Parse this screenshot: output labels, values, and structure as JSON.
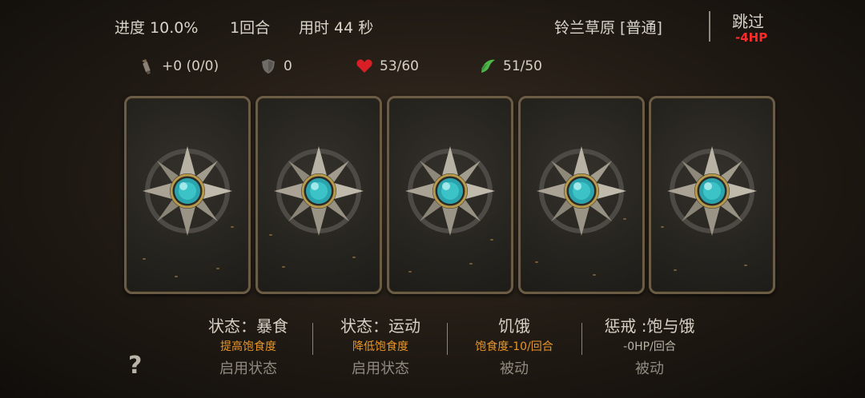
{
  "header": {
    "progress": "进度 10.0%",
    "round": "1回合",
    "time": "用时 44 秒",
    "location": "铃兰草原 [普通]",
    "skip_label": "跳过",
    "skip_cost": "-4HP"
  },
  "stats": {
    "attack": "+0 (0/0)",
    "armor": "0",
    "hp": "53/60",
    "food": "51/50"
  },
  "cards": [
    {
      "icon": "compass-star-icon"
    },
    {
      "icon": "compass-star-icon"
    },
    {
      "icon": "compass-star-icon"
    },
    {
      "icon": "compass-star-icon"
    },
    {
      "icon": "compass-star-icon"
    }
  ],
  "options": [
    {
      "title": "状态：暴食",
      "desc": "提高饱食度",
      "action": "启用状态"
    },
    {
      "title": "状态：运动",
      "desc": "降低饱食度",
      "action": "启用状态"
    },
    {
      "title": "饥饿",
      "desc": "饱食度-10/回合",
      "action": "被动"
    },
    {
      "title": "惩戒 :饱与饿",
      "desc": "-0HP/回合",
      "action": "被动"
    }
  ],
  "help_label": "?",
  "colors": {
    "accent_orange": "#e7952b",
    "hp_red": "#d81f26",
    "food_green": "#4fb64a",
    "gem_cyan": "#3cc3c8",
    "skip_cost_red": "#ff2a2a"
  }
}
